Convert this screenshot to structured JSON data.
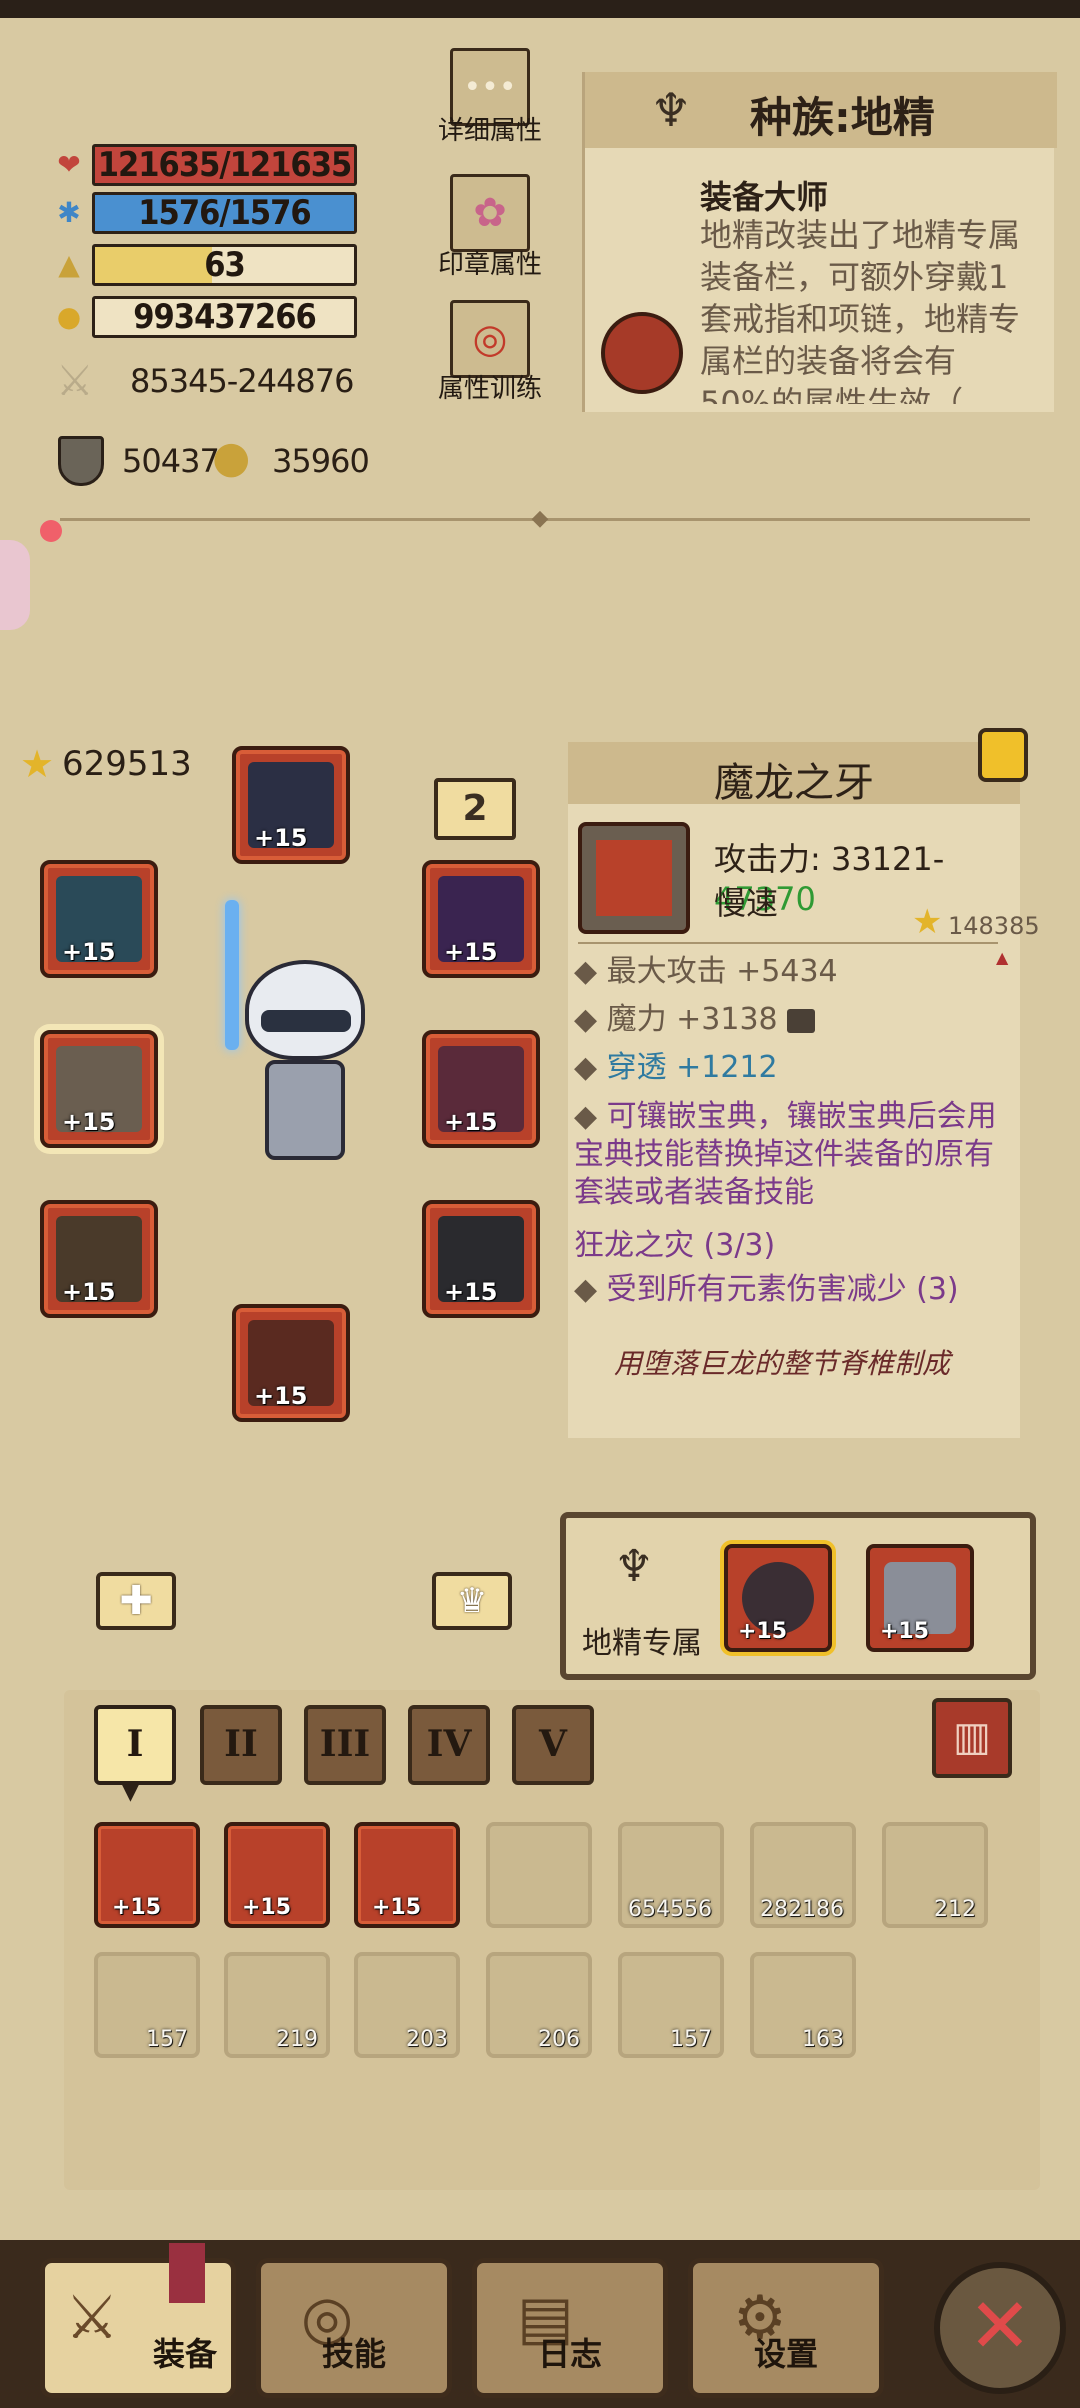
{
  "stats": {
    "hp": "121635/121635",
    "mp": "1576/1576",
    "level": "63",
    "gold": "993437266",
    "attack": "85345-244876",
    "defense": "50437",
    "resist": "35960",
    "hp_fraction": 1.0,
    "mp_fraction": 1.0,
    "exp_fraction": 0.5
  },
  "side_buttons": {
    "detail": "详细属性",
    "seal": "印章属性",
    "training": "属性训练"
  },
  "race": {
    "title": "种族:地精",
    "skill_name": "装备大师",
    "skill_desc": "地精改装出了地精专属装备栏，可额外穿戴1套戒指和项链，地精专属栏的装备将会有50%的属性生效（"
  },
  "equip": {
    "power": "629513",
    "badge": "2",
    "slot_plus": "+15"
  },
  "item": {
    "name": "魔龙之牙",
    "attack_label": "攻击力: 33121-",
    "attack_max": "47370",
    "speed": "慢速",
    "score": "148385",
    "props": [
      "最大攻击 +5434",
      "魔力 +3138",
      "穿透 +1212"
    ],
    "socket_desc": "可镶嵌宝典，镶嵌宝典后会用宝典技能替换掉这件装备的原有套装或者装备技能",
    "set_name": "狂龙之灾 (3/3)",
    "set_bonus": "受到所有元素伤害减少 (3)",
    "flavor": "用堕落巨龙的整节脊椎制成"
  },
  "goblin_slots": {
    "label": "地精专属",
    "plus": "+15"
  },
  "bag_tabs": [
    "I",
    "II",
    "III",
    "IV",
    "V"
  ],
  "bag_row1": [
    {
      "plus": "+15",
      "style": "red"
    },
    {
      "plus": "+15",
      "style": "red"
    },
    {
      "plus": "+15",
      "style": "red"
    },
    {
      "num": "",
      "style": "faded"
    },
    {
      "num": "654556",
      "style": "faded"
    },
    {
      "num": "282186",
      "style": "faded"
    },
    {
      "num": "212",
      "style": "faded"
    }
  ],
  "bag_row2": [
    {
      "num": "157"
    },
    {
      "num": "219"
    },
    {
      "num": "203"
    },
    {
      "num": "206"
    },
    {
      "num": "157"
    },
    {
      "num": "163"
    }
  ],
  "nav": {
    "equip": "装备",
    "skill": "技能",
    "log": "日志",
    "settings": "设置"
  },
  "colors": {
    "hp": "#c2453c",
    "mp": "#3f86c7",
    "exp": "#e9cd6a",
    "penetration": "#2f7aa0",
    "purple": "#7b3a8a",
    "green": "#2f9a34"
  }
}
